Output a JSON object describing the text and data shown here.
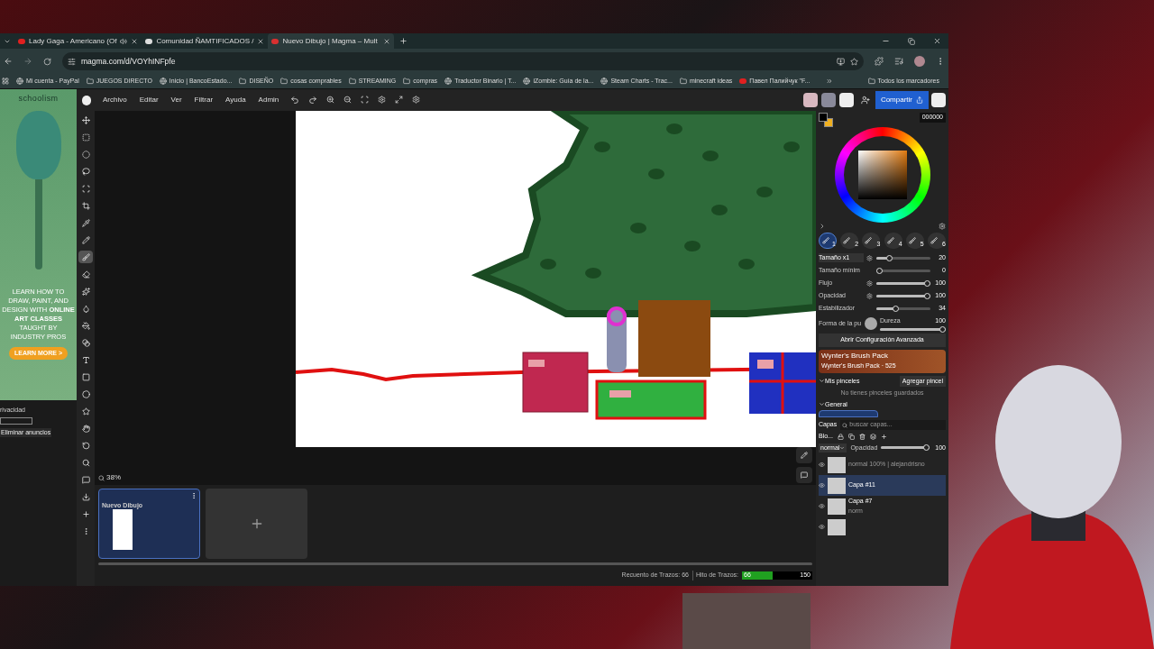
{
  "browser": {
    "tabs": [
      {
        "title": "Lady Gaga - Americano (Of",
        "kind": "video",
        "audio": true,
        "selected": false
      },
      {
        "title": "Comunidad ÑAMTIFICADOS / ",
        "kind": "x",
        "audio": false,
        "selected": false
      },
      {
        "title": "Nuevo Dibujo | Magma – Mult",
        "kind": "magma",
        "audio": false,
        "selected": true
      }
    ],
    "url": "magma.com/d/VOYhINFpfe",
    "bookmarks": [
      {
        "label": "Mi cuenta - PayPal",
        "kind": "site"
      },
      {
        "label": "JUEGOS DIRECTO",
        "kind": "folder"
      },
      {
        "label": "Inicio | BancoEstado...",
        "kind": "site"
      },
      {
        "label": "DISEÑO",
        "kind": "folder"
      },
      {
        "label": "cosas comprables",
        "kind": "folder"
      },
      {
        "label": "STREAMING",
        "kind": "folder"
      },
      {
        "label": "compras",
        "kind": "folder"
      },
      {
        "label": "Traductor Binario | T...",
        "kind": "site"
      },
      {
        "label": "iZombie: Guía de la...",
        "kind": "site"
      },
      {
        "label": "Steam Charts - Trac...",
        "kind": "site"
      },
      {
        "label": "minecraft ideas",
        "kind": "folder"
      },
      {
        "label": "Павел Палийчук \"F...",
        "kind": "video"
      }
    ],
    "all_bookmarks": "Todos los marcadores"
  },
  "ad": {
    "logo": "schoolism",
    "text": "LEARN HOW TO DRAW, PAINT, AND DESIGN WITH **ONLINE ART CLASSES** TAUGHT BY INDUSTRY PROS",
    "button": "LEARN MORE >",
    "privacy": "rivacidad",
    "remove": "Eliminar anuncios"
  },
  "menu": [
    "Archivo",
    "Editar",
    "Ver",
    "Filtrar",
    "Ayuda",
    "Admin"
  ],
  "share_button": "Compartir",
  "tools": [
    {
      "kind": "move",
      "selected": false
    },
    {
      "kind": "rect-select",
      "selected": false
    },
    {
      "kind": "ellipse-select",
      "selected": false
    },
    {
      "kind": "lasso",
      "selected": false
    },
    {
      "kind": "transform",
      "selected": false
    },
    {
      "kind": "crop",
      "selected": false
    },
    {
      "kind": "eyedropper",
      "selected": false
    },
    {
      "kind": "pencil",
      "selected": false
    },
    {
      "kind": "brush",
      "selected": true
    },
    {
      "kind": "eraser",
      "selected": false
    },
    {
      "kind": "smudge",
      "selected": false
    },
    {
      "kind": "blur",
      "selected": false
    },
    {
      "kind": "fill",
      "selected": false
    },
    {
      "kind": "gradient",
      "selected": false
    },
    {
      "kind": "text",
      "selected": false
    },
    {
      "kind": "rectangle",
      "selected": false
    },
    {
      "kind": "circle",
      "selected": false
    },
    {
      "kind": "star",
      "selected": false
    },
    {
      "kind": "hand",
      "selected": false
    },
    {
      "kind": "rotate",
      "selected": false
    },
    {
      "kind": "zoom",
      "selected": false
    },
    {
      "kind": "comment",
      "selected": false
    },
    {
      "kind": "export",
      "selected": false
    },
    {
      "kind": "add",
      "selected": false
    },
    {
      "kind": "more",
      "selected": false
    }
  ],
  "zoom": "38%",
  "drawings": [
    {
      "title": "Nuevo Dibujo",
      "selected": true
    }
  ],
  "status": {
    "stroke_count": "Recuento de Trazos: 66",
    "milestone_label": "Hito de Trazos:",
    "milestone_value": "66",
    "milestone_goal": "150",
    "level": 0.44
  },
  "color": {
    "hex": "000000"
  },
  "brush_slots": [
    {
      "number": "1",
      "selected": true
    },
    {
      "number": "2",
      "selected": false
    },
    {
      "number": "3",
      "selected": false
    },
    {
      "number": "4",
      "selected": false
    },
    {
      "number": "5",
      "selected": false
    },
    {
      "number": "6",
      "selected": false
    }
  ],
  "brush_settings": [
    {
      "label": "Tamaño x1",
      "value": "20",
      "level": 0.2,
      "pressure": true
    },
    {
      "label": "Tamaño mínim",
      "value": "0",
      "level": 0,
      "pressure": false
    },
    {
      "label": "Flujo",
      "value": "100",
      "level": 1,
      "pressure": true
    },
    {
      "label": "Opacidad",
      "value": "100",
      "level": 1,
      "pressure": true
    },
    {
      "label": "Estabilizador",
      "value": "34",
      "level": 0.34,
      "pressure": false
    }
  ],
  "brush_shape_label": "Forma de la pu",
  "hardness": {
    "label": "Dureza",
    "value": "100",
    "level": 1
  },
  "advanced_button": "Abrir Configuración Avanzada",
  "brush_pack": {
    "title": "Wynter's Brush Pack",
    "subtitle": "Wynter's Brush Pack · 525"
  },
  "my_brushes": {
    "label": "Mis pinceles",
    "add": "Agregar pincel",
    "empty": "No tienes pinceles guardados",
    "general": "General"
  },
  "layers": {
    "title": "Capas",
    "search_placeholder": "buscar capas...",
    "lock_label": "Blo...",
    "blend": "normal",
    "opacity_label": "Opacidad",
    "opacity": "100",
    "level": 1,
    "items": [
      {
        "meta": "normal 100% | alejandrisno",
        "selected": false
      },
      {
        "name": "Capa #11",
        "selected": true
      },
      {
        "name": "Capa #7",
        "meta": "norm",
        "selected": false
      },
      {
        "selected": false
      }
    ]
  }
}
